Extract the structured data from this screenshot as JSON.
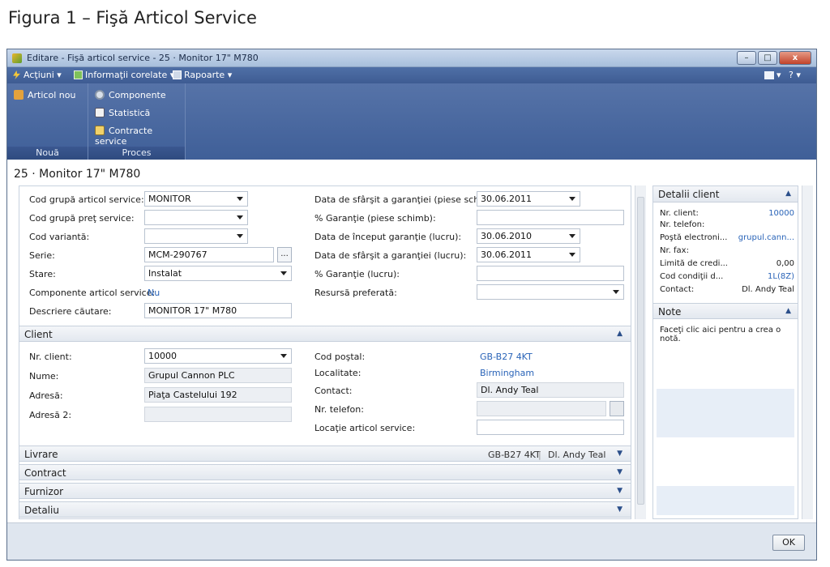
{
  "figure_caption": "Figura 1 – Fişă Articol Service",
  "window": {
    "title": "Editare - Fişă articol service - 25 · Monitor 17\" M780",
    "min": "–",
    "max": "□",
    "close": "x"
  },
  "menu": {
    "actions": "Acţiuni ▾",
    "related": "Informaţii corelate ▾",
    "reports": "Rapoarte ▾",
    "help": "? ▾"
  },
  "ribbon": {
    "new_item": "Articol nou",
    "group_new": "Nouă",
    "components": "Componente",
    "statistics": "Statistică",
    "service_contracts": "Contracte service",
    "group_process": "Proces"
  },
  "record_title": "25 · Monitor 17\" M780",
  "general": {
    "service_item_group_label": "Cod grupă articol service:",
    "service_item_group_value": "MONITOR",
    "service_price_group_label": "Cod grupă preţ service:",
    "service_price_group_value": "",
    "variant_label": "Cod variantă:",
    "variant_value": "",
    "serial_label": "Serie:",
    "serial_value": "MCM-290767",
    "serial_btn": "...",
    "status_label": "Stare:",
    "status_value": "Instalat",
    "components_label": "Componente articol service:",
    "components_value": "Nu",
    "search_desc_label": "Descriere căutare:",
    "search_desc_value": "MONITOR 17\" M780",
    "warranty_end_parts_label": "Data de sfârşit a garanţiei (piese schimb):",
    "warranty_end_parts_value": "30.06.2011",
    "warranty_pct_parts_label": "% Garanţie (piese schimb):",
    "warranty_pct_parts_value": "",
    "warranty_start_labor_label": "Data de început garanţie (lucru):",
    "warranty_start_labor_value": "30.06.2010",
    "warranty_end_labor_label": "Data de sfârşit a garanţiei (lucru):",
    "warranty_end_labor_value": "30.06.2011",
    "warranty_pct_labor_label": "% Garanţie (lucru):",
    "warranty_pct_labor_value": "",
    "preferred_resource_label": "Resursă preferată:",
    "preferred_resource_value": ""
  },
  "client": {
    "header": "Client",
    "customer_no_label": "Nr. client:",
    "customer_no_value": "10000",
    "name_label": "Nume:",
    "name_value": "Grupul Cannon PLC",
    "address_label": "Adresă:",
    "address_value": "Piaţa Castelului 192",
    "address2_label": "Adresă 2:",
    "address2_value": "",
    "postcode_label": "Cod poştal:",
    "postcode_value": "GB-B27 4KT",
    "city_label": "Localitate:",
    "city_value": "Birmingham",
    "contact_label": "Contact:",
    "contact_value": "Dl. Andy Teal",
    "phone_label": "Nr. telefon:",
    "phone_value": "",
    "location_label": "Locaţie articol service:",
    "location_value": ""
  },
  "tabs": {
    "shipping": "Livrare",
    "shipping_sum1": "GB-B27 4KT",
    "shipping_sum2": "Dl. Andy Teal",
    "contract": "Contract",
    "vendor": "Furnizor",
    "detail": "Detaliu"
  },
  "factbox": {
    "customer_details": "Detalii client",
    "customer_no_label": "Nr. client:",
    "customer_no_value": "10000",
    "phone_label": "Nr. telefon:",
    "email_label": "Poştă electroni...",
    "email_value": "grupul.cann...",
    "fax_label": "Nr. fax:",
    "credit_label": "Limită de credi...",
    "credit_value": "0,00",
    "terms_label": "Cod condiţii d...",
    "terms_value": "1L(8Z)",
    "contact_label": "Contact:",
    "contact_value": "Dl. Andy Teal",
    "notes": "Note",
    "notes_hint": "Faceţi clic aici pentru a crea o notă."
  },
  "ok": "OK"
}
